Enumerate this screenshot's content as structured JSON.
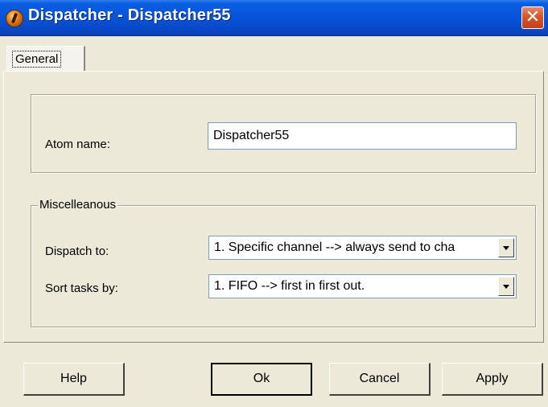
{
  "window": {
    "title": "Dispatcher - Dispatcher55",
    "close_glyph": "✕",
    "icon": "app-icon"
  },
  "tabs": [
    {
      "label": "General",
      "selected": true
    }
  ],
  "general": {
    "atom_name_label": "Atom name:",
    "atom_name_value": "Dispatcher55",
    "misc_group_label": "Miscelleanous",
    "dispatch_to_label": "Dispatch to:",
    "dispatch_to_value": "1. Specific channel --> always send to cha",
    "sort_tasks_label": "Sort tasks by:",
    "sort_tasks_value": "1. FIFO --> first in first out."
  },
  "buttons": {
    "help": "Help",
    "ok": "Ok",
    "cancel": "Cancel",
    "apply": "Apply"
  },
  "colors": {
    "titlebar": "#0a5ee0",
    "dialog_bg": "#ece9d8",
    "close_button": "#d9542a"
  }
}
